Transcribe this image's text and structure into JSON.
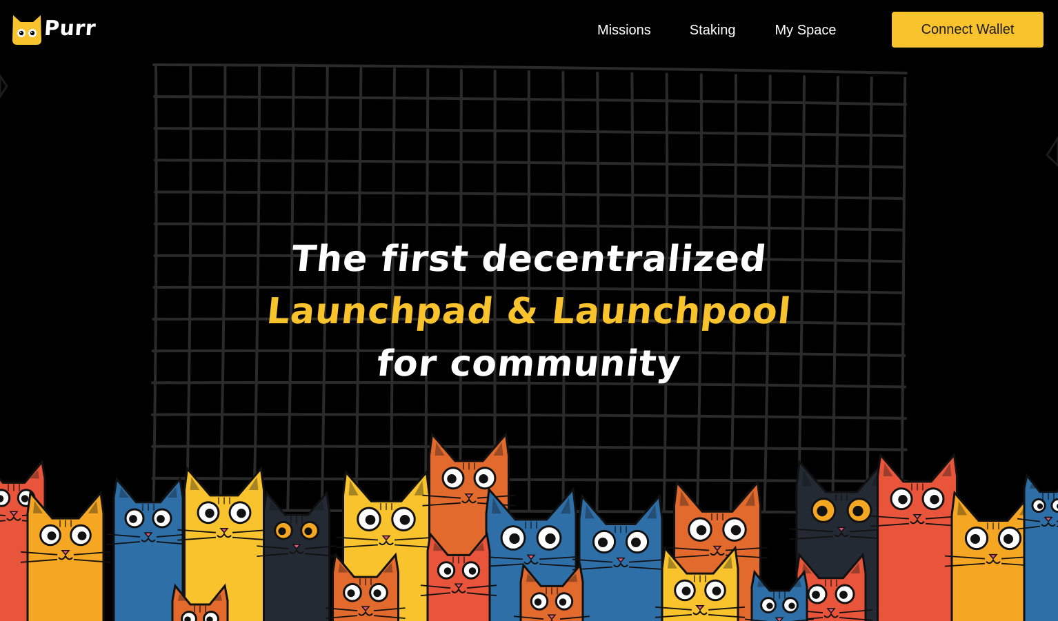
{
  "brand": {
    "name": "Purr",
    "logo_icon": "cat-face-icon",
    "accent_color": "#f9c32e"
  },
  "nav": {
    "links": [
      "Missions",
      "Staking",
      "My Space"
    ],
    "connect_label": "Connect Wallet"
  },
  "hero": {
    "line1": "The first decentralized",
    "line2": "Launchpad & Launchpool",
    "line3": "for community"
  },
  "illustration": {
    "subject": "cats-illustration",
    "palette": [
      "#e8553a",
      "#f5a623",
      "#f9c32e",
      "#2e6fa8",
      "#232a33",
      "#e36a2d"
    ]
  }
}
